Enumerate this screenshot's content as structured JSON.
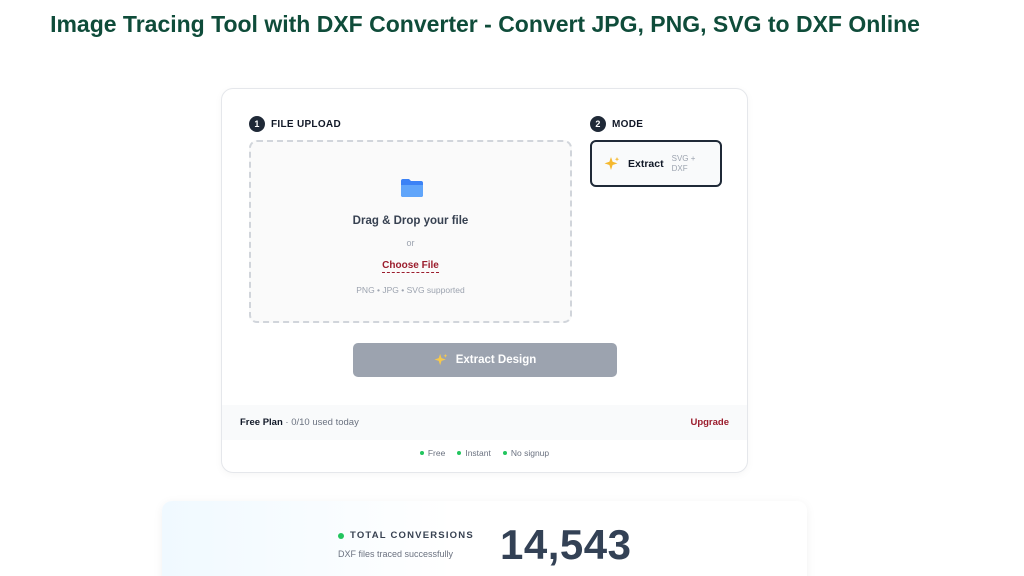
{
  "page": {
    "title": "Image Tracing Tool with DXF Converter - Convert JPG, PNG, SVG to DXF Online"
  },
  "upload": {
    "step_number": "1",
    "step_label": "FILE UPLOAD",
    "icon": "folder-icon",
    "drop_title": "Drag & Drop your file",
    "or_text": "or",
    "choose_label": "Choose File",
    "supported": "PNG • JPG • SVG supported"
  },
  "mode": {
    "step_number": "2",
    "step_label": "MODE",
    "icon": "sparkle-icon",
    "option_label": "Extract",
    "option_sub": "SVG + DXF"
  },
  "action": {
    "extract_label": "Extract Design",
    "icon": "sparkle-icon"
  },
  "plan": {
    "name": "Free Plan",
    "usage": " · 0/10 used today",
    "upgrade_label": "Upgrade"
  },
  "features": [
    "Free",
    "Instant",
    "No signup"
  ],
  "stats": {
    "label": "TOTAL CONVERSIONS",
    "sub": "DXF files traced successfully",
    "value": "14,543"
  },
  "colors": {
    "title": "#0f4c3a",
    "accent": "#9b1c2c",
    "success": "#22c55e",
    "disabled_button": "#9ca3af"
  }
}
